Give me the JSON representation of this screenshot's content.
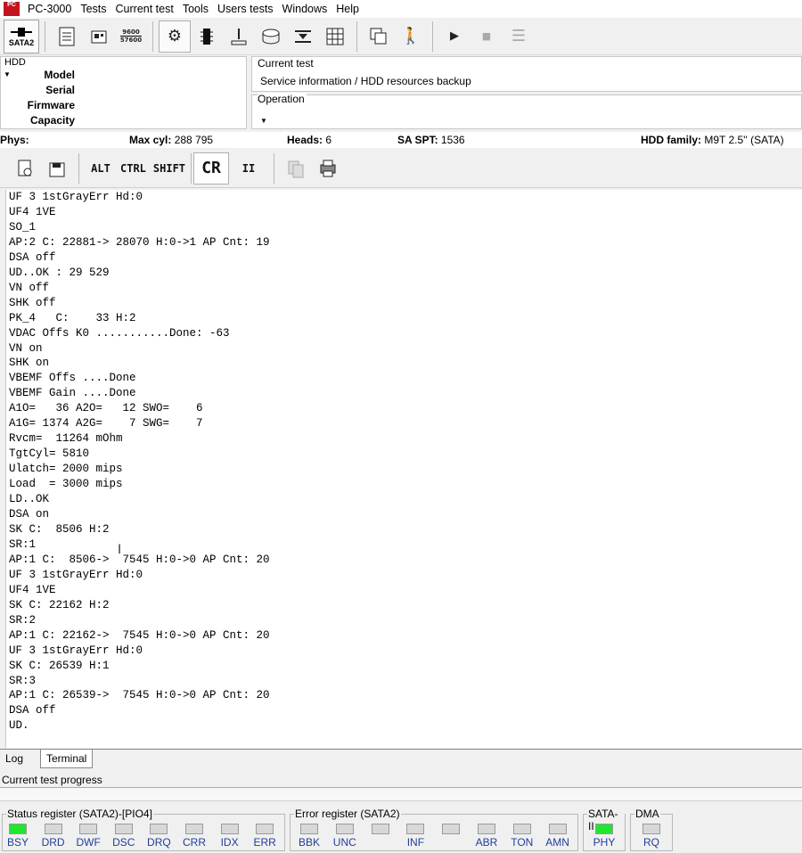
{
  "menubar": {
    "app_icon_text": "PC",
    "items": [
      "PC-3000",
      "Tests",
      "Current test",
      "Tools",
      "Users tests",
      "Windows",
      "Help"
    ]
  },
  "toolbar": {
    "sata_label": "SATA2",
    "baud_top": "9600",
    "baud_bottom": "57600"
  },
  "hdd": {
    "title": "HDD",
    "labels": [
      "Model",
      "Serial",
      "Firmware",
      "Capacity"
    ]
  },
  "current_test": {
    "title": "Current test",
    "value": "Service information / HDD resources backup"
  },
  "operation": {
    "title": "Operation"
  },
  "info": {
    "phys_label": "Phys:",
    "maxcyl_label": "Max cyl:",
    "maxcyl_value": "288 795",
    "heads_label": "Heads:",
    "heads_value": "6",
    "spt_label": "SA SPT:",
    "spt_value": "1536",
    "family_label": "HDD family:",
    "family_value": "M9T 2.5'' (SATA)"
  },
  "term_toolbar": {
    "alt": "ALT",
    "ctrl": "CTRL",
    "shift": "SHIFT",
    "cr": "CR",
    "pause": "II"
  },
  "terminal_lines": [
    "UF 3 1stGrayErr Hd:0",
    "UF4 1VE",
    "SO_1",
    "AP:2 C: 22881-> 28070 H:0->1 AP Cnt: 19",
    "DSA off",
    "UD..OK : 29 529",
    "VN off",
    "SHK off",
    "PK_4   C:    33 H:2",
    "VDAC Offs K0 ...........Done: -63",
    "VN on",
    "SHK on",
    "VBEMF Offs ....Done",
    "VBEMF Gain ....Done",
    "A1O=   36 A2O=   12 SWO=    6",
    "A1G= 1374 A2G=    7 SWG=    7",
    "Rvcm=  11264 mOhm",
    "TgtCyl= 5810",
    "Ulatch= 2000 mips",
    "Load  = 3000 mips",
    "LD..OK",
    "DSA on",
    "SK C:  8506 H:2",
    "SR:1",
    "AP:1 C:  8506->  7545 H:0->0 AP Cnt: 20",
    "UF 3 1stGrayErr Hd:0",
    "UF4 1VE",
    "SK C: 22162 H:2",
    "SR:2",
    "AP:1 C: 22162->  7545 H:0->0 AP Cnt: 20",
    "UF 3 1stGrayErr Hd:0",
    "SK C: 26539 H:1",
    "SR:3",
    "AP:1 C: 26539->  7545 H:0->0 AP Cnt: 20",
    "DSA off",
    "UD."
  ],
  "tabs": [
    "Log",
    "Terminal"
  ],
  "progress": {
    "label": "Current test progress",
    "value": 0
  },
  "status_register": {
    "title": "Status register (SATA2)-[PIO4]",
    "leds": [
      {
        "label": "BSY",
        "on": true
      },
      {
        "label": "DRD",
        "on": false
      },
      {
        "label": "DWF",
        "on": false
      },
      {
        "label": "DSC",
        "on": false
      },
      {
        "label": "DRQ",
        "on": false
      },
      {
        "label": "CRR",
        "on": false
      },
      {
        "label": "IDX",
        "on": false
      },
      {
        "label": "ERR",
        "on": false
      }
    ]
  },
  "error_register": {
    "title": "Error register (SATA2)",
    "leds": [
      {
        "label": "BBK",
        "on": false
      },
      {
        "label": "UNC",
        "on": false
      },
      {
        "label": "",
        "on": false
      },
      {
        "label": "INF",
        "on": false
      },
      {
        "label": "",
        "on": false
      },
      {
        "label": "ABR",
        "on": false
      },
      {
        "label": "TON",
        "on": false
      },
      {
        "label": "AMN",
        "on": false
      }
    ]
  },
  "sata2_box": {
    "title": "SATA-II",
    "leds": [
      {
        "label": "PHY",
        "on": true
      }
    ]
  },
  "dma_box": {
    "title": "DMA",
    "leds": [
      {
        "label": "RQ",
        "on": false
      }
    ]
  },
  "colors": {
    "led_on": "#21e62f",
    "led_off": "#d8d8d8",
    "led_label": "#1f3f9a"
  },
  "icons": [
    "connect-icon",
    "document-icon",
    "board-icon",
    "gear-icon",
    "chip-icon",
    "tool-icon",
    "disk-icon",
    "head-icon",
    "grid-icon",
    "windows-icon",
    "user-exit-icon",
    "play-icon",
    "stop-icon",
    "list-icon"
  ]
}
